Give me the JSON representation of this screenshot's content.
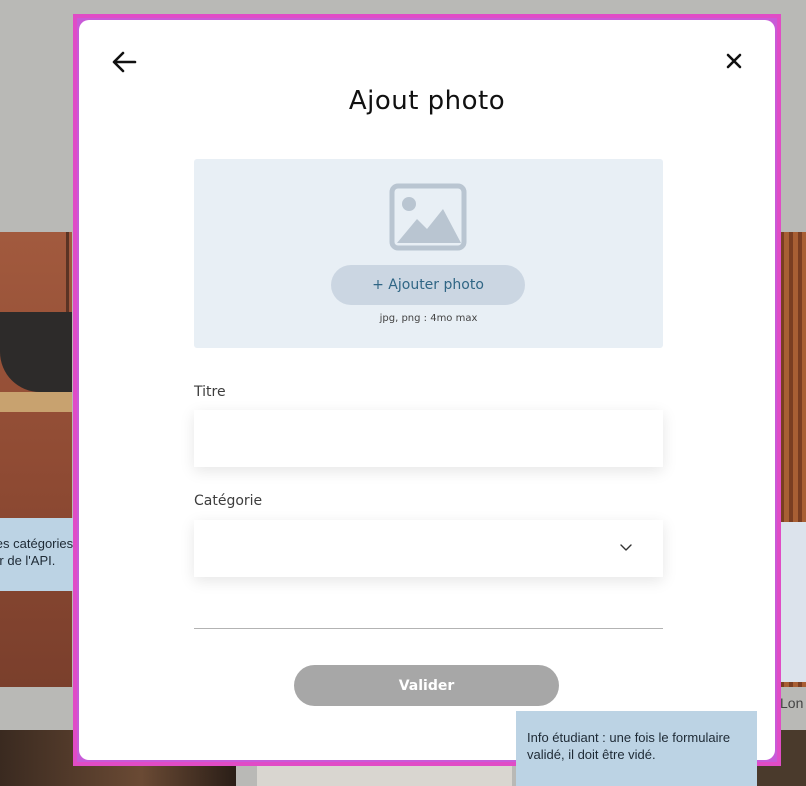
{
  "background": {
    "caption_fragment": "Lon"
  },
  "notes": {
    "left_text_line1": "ant : les catégories",
    "left_text_line2": "rovenir de l'API.",
    "right_text": "Info étudiant : une fois le formulaire validé, il doit être vidé."
  },
  "modal": {
    "title": "Ajout photo",
    "back_icon": "arrow-left-icon",
    "close_icon": "close-icon",
    "upload": {
      "icon": "image-placeholder-icon",
      "button_label": "+ Ajouter photo",
      "hint": "jpg, png : 4mo max"
    },
    "fields": {
      "title_label": "Titre",
      "title_value": "",
      "category_label": "Catégorie",
      "category_value": ""
    },
    "submit_label": "Valider"
  },
  "colors": {
    "modal_border": "#e04cc6",
    "upload_bg": "#e8eff5",
    "add_button_bg": "#cbd6e2",
    "add_button_text": "#306685",
    "submit_bg": "#a7a7a7",
    "note_bg": "#bcd3e4"
  }
}
